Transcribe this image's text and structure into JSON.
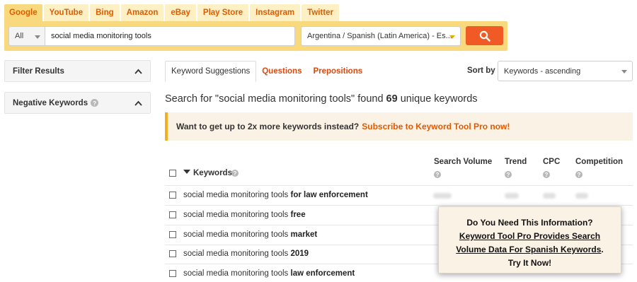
{
  "engine_tabs": [
    {
      "label": "Google",
      "active": true
    },
    {
      "label": "YouTube",
      "active": false
    },
    {
      "label": "Bing",
      "active": false
    },
    {
      "label": "Amazon",
      "active": false
    },
    {
      "label": "eBay",
      "active": false
    },
    {
      "label": "Play Store",
      "active": false
    },
    {
      "label": "Instagram",
      "active": false
    },
    {
      "label": "Twitter",
      "active": false
    }
  ],
  "search": {
    "scope": "All",
    "query": "social media monitoring tools",
    "region": "Argentina / Spanish (Latin America) - Es..."
  },
  "sidebar": {
    "filter_results": "Filter Results",
    "negative_keywords": "Negative Keywords"
  },
  "content_tabs": {
    "suggestions": "Keyword Suggestions",
    "questions": "Questions",
    "prepositions": "Prepositions"
  },
  "sort": {
    "label": "Sort by",
    "value": "Keywords - ascending"
  },
  "summary": {
    "prefix": "Search for \"social media monitoring tools\" found",
    "count": "69",
    "suffix": "unique keywords"
  },
  "promo": {
    "text": "Want to get up to 2x more keywords instead?",
    "link": "Subscribe to Keyword Tool Pro now!"
  },
  "table": {
    "headers": {
      "keywords": "Keywords",
      "search_volume": "Search Volume",
      "trend": "Trend",
      "cpc": "CPC",
      "competition": "Competition"
    },
    "rows": [
      {
        "base": "social media monitoring tools",
        "suffix": "for law enforcement"
      },
      {
        "base": "social media monitoring tools",
        "suffix": "free"
      },
      {
        "base": "social media monitoring tools",
        "suffix": "market"
      },
      {
        "base": "social media monitoring tools",
        "suffix": "2019"
      },
      {
        "base": "social media monitoring tools",
        "suffix": "law enforcement"
      }
    ]
  },
  "popup": {
    "line1": "Do You Need This Information?",
    "link_line1": "Keyword Tool Pro Provides Search",
    "link_line2": "Volume Data For Spanish Keywords",
    "period": ".",
    "line3": "Try It Now!"
  },
  "colors": {
    "accent": "#f05a24",
    "brand_yellow": "#f9d97d",
    "link_orange": "#e05a00"
  }
}
